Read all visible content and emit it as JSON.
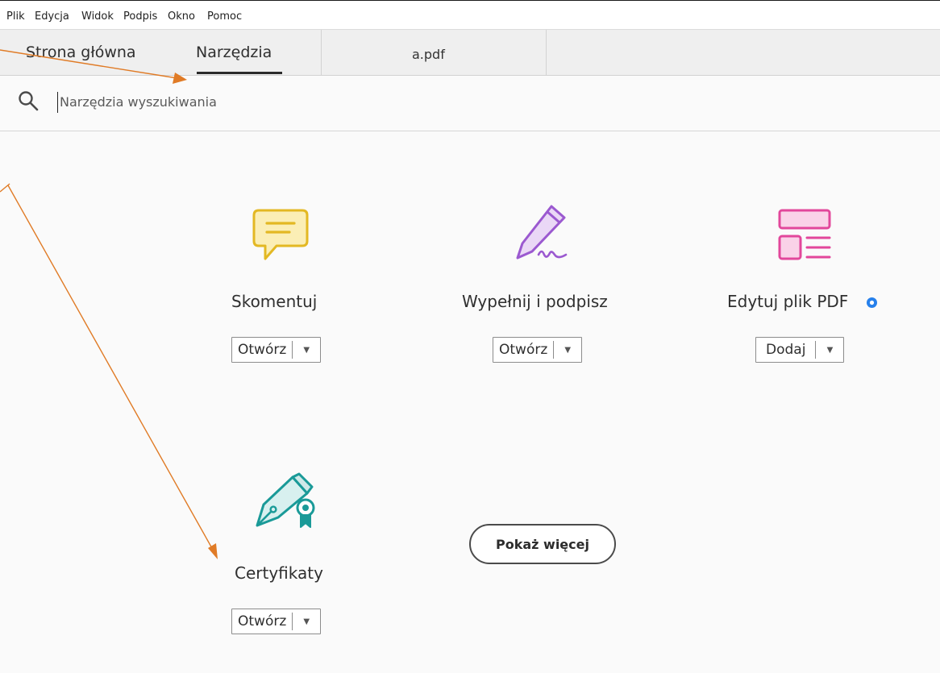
{
  "menu": [
    "Plik",
    "Edycja",
    "Widok",
    "Podpis",
    "Okno",
    "Pomoc"
  ],
  "tabs": {
    "home": "Strona główna",
    "tools": "Narzędzia",
    "document": "a.pdf"
  },
  "search": {
    "placeholder": "Narzędzia wyszukiwania"
  },
  "tools": [
    {
      "label": "Skomentuj",
      "button": "Otwórz",
      "icon": "comment-icon",
      "color": "#e3b823"
    },
    {
      "label": "Wypełnij i podpisz",
      "button": "Otwórz",
      "icon": "fill-sign-icon",
      "color": "#9b59d0"
    },
    {
      "label": "Edytuj plik PDF",
      "button": "Dodaj",
      "icon": "edit-pdf-icon",
      "color": "#e2479b",
      "premium": true
    },
    {
      "label": "Certyfikaty",
      "button": "Otwórz",
      "icon": "certificate-icon",
      "color": "#1a9a98"
    }
  ],
  "show_more": "Pokaż więcej",
  "colors": {
    "annotation_arrow": "#e07b26",
    "premium_badge": "#2680eb"
  }
}
